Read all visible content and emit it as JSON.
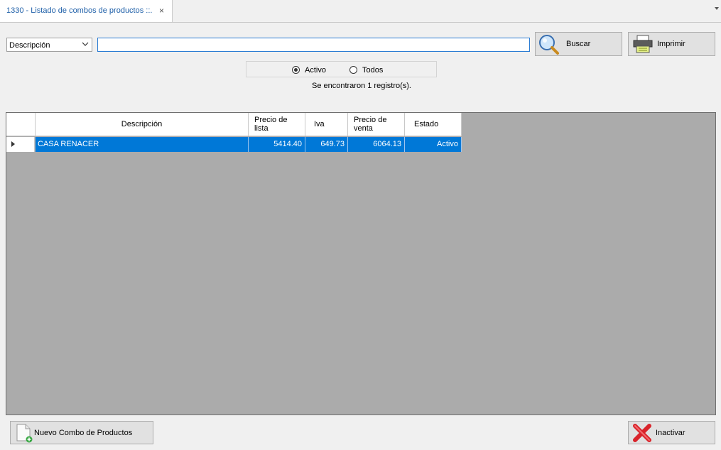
{
  "tab": {
    "title": "1330 - Listado de combos de productos ::.",
    "close": "×"
  },
  "filter": {
    "field_selected": "Descripción",
    "search_value": ""
  },
  "buttons": {
    "search": "Buscar",
    "print": "Imprimir",
    "new_combo": "Nuevo Combo de Productos",
    "deactivate": "Inactivar"
  },
  "radios": {
    "active_label": "Activo",
    "all_label": "Todos",
    "selected": "Activo"
  },
  "status_text": "Se encontraron 1 registro(s).",
  "table": {
    "headers": {
      "description": "Descripción",
      "list_price": "Precio de lista",
      "vat": "Iva",
      "sale_price": "Precio de venta",
      "status": "Estado"
    },
    "rows": [
      {
        "description": "CASA RENACER",
        "list_price": "5414.40",
        "vat": "649.73",
        "sale_price": "6064.13",
        "status": "Activo"
      }
    ]
  },
  "colors": {
    "accent": "#0078d7",
    "tab_text": "#1e5fa8",
    "grid_background": "#ababab",
    "delete_icon": "#d9232a"
  }
}
